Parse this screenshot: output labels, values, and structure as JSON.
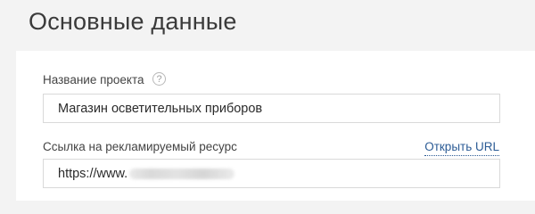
{
  "header": {
    "title": "Основные данные"
  },
  "form": {
    "project_name": {
      "label": "Название проекта",
      "help_icon": "question-circle-icon",
      "help_glyph": "?",
      "value": "Магазин осветительных приборов"
    },
    "ad_url": {
      "label": "Ссылка на рекламируемый ресурс",
      "open_link_label": "Открыть URL",
      "value_visible": "https://www."
    }
  },
  "colors": {
    "page_background": "#f3f3f3",
    "card_background": "#ffffff",
    "link": "#2b5b95",
    "input_border": "#d9d9d9"
  }
}
